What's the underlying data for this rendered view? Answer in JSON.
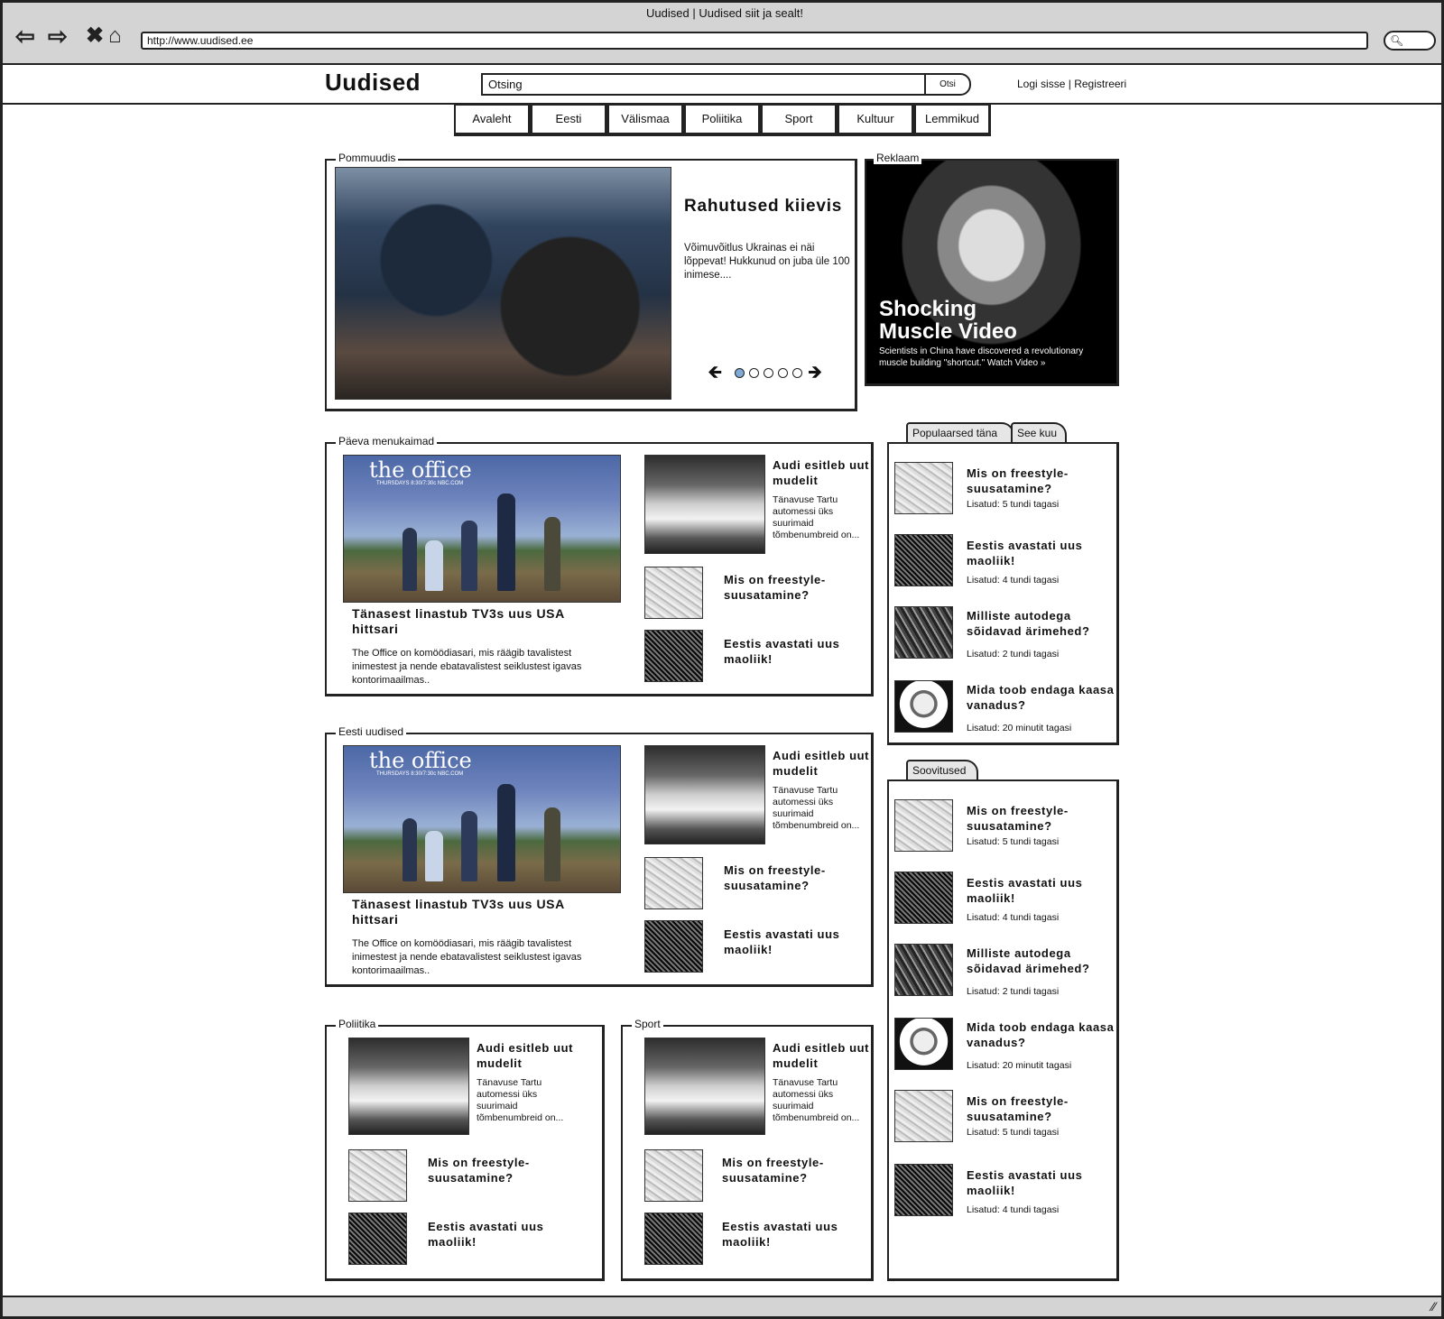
{
  "browser": {
    "window_title": "Uudised | Uudised siit ja sealt!",
    "url": "http://www.uudised.ee"
  },
  "header": {
    "logo": "Uudised",
    "search_value": "Otsing",
    "search_button": "Otsi",
    "login_link": "Logi sisse",
    "separator": "|",
    "register_link": "Registreeri"
  },
  "nav": [
    "Avaleht",
    "Eesti",
    "Välismaa",
    "Poliitika",
    "Sport",
    "Kultuur",
    "Lemmikud"
  ],
  "featured": {
    "section_label": "Pommuudis",
    "title": "Rahutused kiievis",
    "text": "Võimuvõitlus Ukrainas ei näi lõppevat! Hukkunud on juba üle 100 inimese....",
    "dots": 5,
    "active_dot": 0
  },
  "ad": {
    "section_label": "Reklaam",
    "headline_1": "Shocking",
    "headline_2": "Muscle Video",
    "text": "Scientists in China have discovered a revolutionary muscle building \"shortcut.\" Watch Video »"
  },
  "main_story": {
    "image_title": "the office",
    "image_sub": "THURSDAYS 8:30/7:30c NBC.COM",
    "title": "Tänasest linastub TV3s uus USA hittsari",
    "text": "The Office on komöödiasari, mis räägib tavalistest inimestest ja nende ebatavalistest seiklustest igavas kontorimaailmas.."
  },
  "audi": {
    "title": "Audi esitleb uut mudelit",
    "text": "Tänavuse Tartu automessi üks suurimaid tõmbenumbreid on..."
  },
  "ski_title": "Mis on freestyle-suusatamine?",
  "maoliik_title": "Eestis avastati uus maoliik!",
  "sections": {
    "daily": "Päeva menukaimad",
    "estonian": "Eesti uudised",
    "politics": "Poliitika",
    "sport": "Sport"
  },
  "popular": {
    "tabs": [
      "Populaarsed täna",
      "See kuu"
    ],
    "items": [
      {
        "title": "Mis on freestyle-suusatamine?",
        "meta": "Lisatud: 5 tundi tagasi"
      },
      {
        "title": "Eestis avastati uus maoliik!",
        "meta": "Lisatud: 4 tundi tagasi"
      },
      {
        "title": "Milliste autodega sõidavad ärimehed?",
        "meta": "Lisatud: 2 tundi tagasi"
      },
      {
        "title": "Mida toob endaga kaasa vanadus?",
        "meta": "Lisatud: 20 minutit tagasi"
      }
    ]
  },
  "recommended": {
    "tab": "Soovitused",
    "items": [
      {
        "title": "Mis on freestyle-suusatamine?",
        "meta": "Lisatud: 5 tundi tagasi"
      },
      {
        "title": "Eestis avastati uus maoliik!",
        "meta": "Lisatud: 4 tundi tagasi"
      },
      {
        "title": "Milliste autodega sõidavad ärimehed?",
        "meta": "Lisatud: 2 tundi tagasi"
      },
      {
        "title": "Mida toob endaga kaasa vanadus?",
        "meta": "Lisatud: 20 minutit tagasi"
      },
      {
        "title": "Mis on freestyle-suusatamine?",
        "meta": "Lisatud: 5 tundi tagasi"
      },
      {
        "title": "Eestis avastati uus maoliik!",
        "meta": "Lisatud: 4 tundi tagasi"
      }
    ]
  },
  "icons": {
    "back": "back-arrow-icon",
    "forward": "forward-arrow-icon",
    "stop": "close-icon",
    "home": "home-icon",
    "search": "search-icon",
    "prev": "prev-arrow-icon",
    "next": "next-arrow-icon"
  },
  "colors": {
    "chrome_gray": "#d4d4d4",
    "active_dot": "#7fa9d6",
    "tab_gray": "#e6e6e6"
  }
}
